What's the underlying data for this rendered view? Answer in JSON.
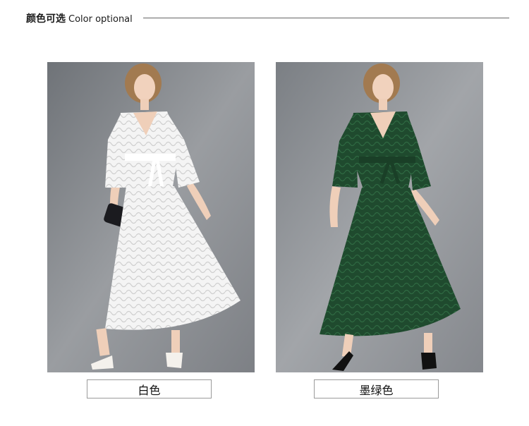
{
  "header": {
    "title_cn": "颜色可选",
    "title_en": "Color optional"
  },
  "variants": [
    {
      "label": "白色",
      "dress_color": "#f2f2f2",
      "image": "white lace dress photo"
    },
    {
      "label": "墨绿色",
      "dress_color": "#1f4a2e",
      "image": "dark green lace dress photo"
    }
  ],
  "colors": {
    "background": "#ffffff",
    "photo_bg": "#8a8d92",
    "divider": "#666666"
  }
}
